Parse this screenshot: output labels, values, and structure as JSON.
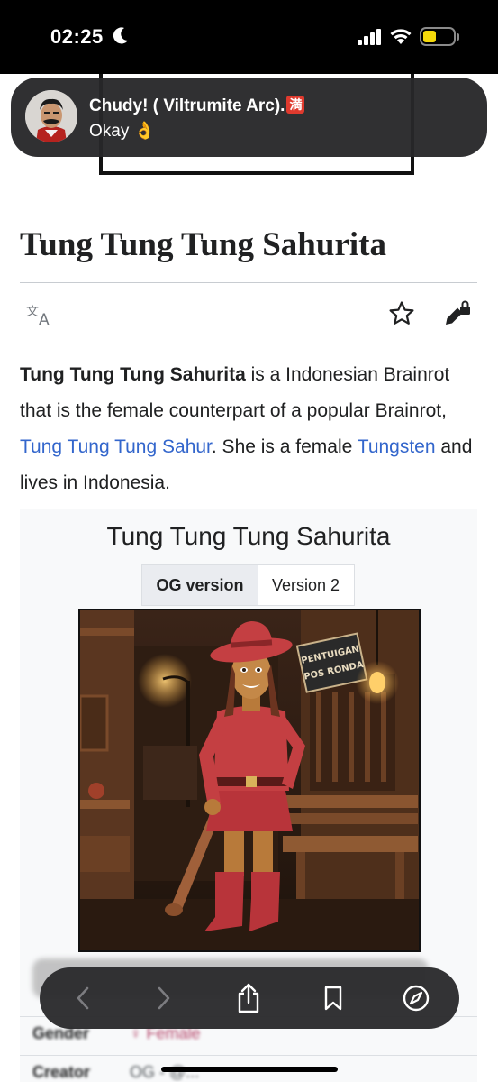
{
  "status_bar": {
    "time": "02:25",
    "icons": [
      "moon-icon",
      "signal-icon",
      "wifi-icon",
      "battery-icon"
    ]
  },
  "notification": {
    "sender": "Chudy! ( Viltrumite Arc).",
    "sender_emoji": "満",
    "message": "Okay 👌"
  },
  "article": {
    "title": "Tung Tung Tung Sahurita",
    "lead": {
      "bold": "Tung Tung Tung Sahurita",
      "text1": " is a Indonesian Brainrot that is the female counterpart of a popular Brainrot, ",
      "link1": "Tung Tung Tung Sahur",
      "text2": ". She is a female ",
      "link2": "Tungsten",
      "text3": " and lives in Indonesia."
    },
    "actions": [
      "language-icon",
      "star-icon",
      "edit-locked-icon"
    ]
  },
  "infobox": {
    "title": "Tung Tung Tung Sahurita",
    "tabs": [
      "OG version",
      "Version 2"
    ],
    "active_tab": "OG version",
    "sign_text": [
      "PENTUIGAN",
      "POS RONDA"
    ],
    "rows": [
      {
        "label": "Gender",
        "value": "♀ Female"
      },
      {
        "label": "Creator",
        "value": "OG - @..."
      }
    ]
  },
  "toolbar": {
    "buttons": [
      "back-icon",
      "forward-icon",
      "share-icon",
      "bookmarks-icon",
      "compass-icon"
    ]
  },
  "colors": {
    "link": "#3366cc",
    "text": "#202122",
    "rule": "#c8ccd1",
    "infobox_bg": "#f8f9fa",
    "notification_bg": "#28282a",
    "toolbar_bg": "#2c2c2e",
    "battery": "#f5d90a"
  }
}
